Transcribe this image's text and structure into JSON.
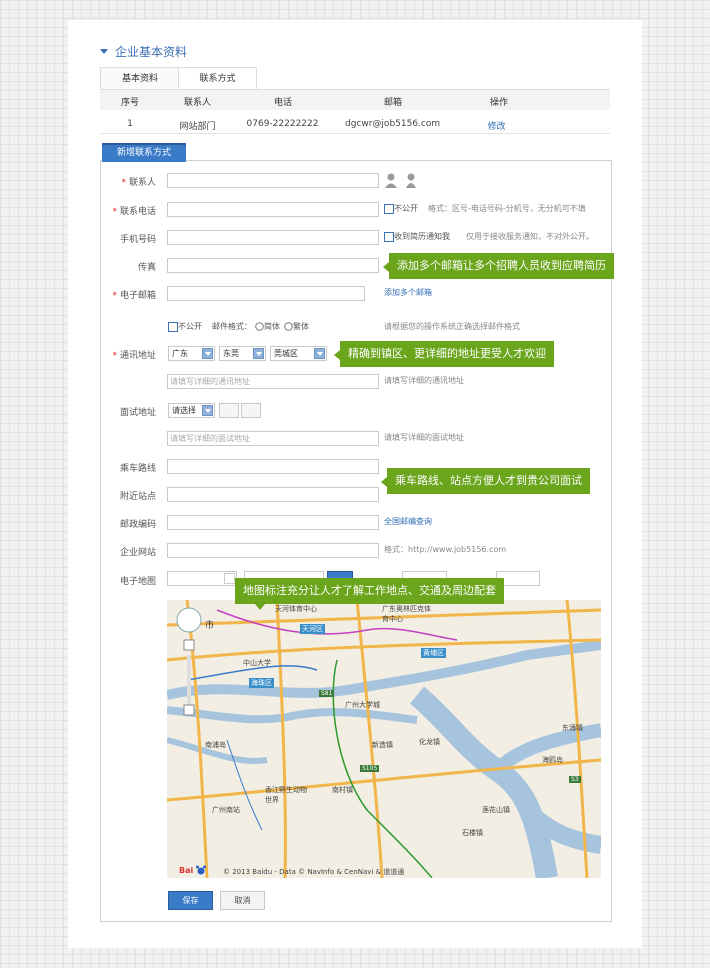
{
  "section_title": "企业基本资料",
  "tabs": [
    {
      "label": "基本资料"
    },
    {
      "label": "联系方式"
    }
  ],
  "table": {
    "headers": [
      "序号",
      "联系人",
      "电话",
      "邮箱",
      "操作"
    ],
    "rows": [
      {
        "no": "1",
        "contact": "网站部门",
        "phone": "0769-22222222",
        "email": "dgcwr@job5156.com",
        "action": "修改"
      }
    ]
  },
  "new_contact_button": "新增联系方式",
  "form": {
    "contact_label": "联系人",
    "phone_label": "联系电话",
    "phone_private": "不公开",
    "phone_hint": "格式：区号-电话号码-分机号，无分机可不填",
    "mobile_label": "手机号码",
    "mobile_notify": "收到简历通知我",
    "mobile_hint": "仅用于接收服务通知，不对外公开。",
    "fax_label": "传真",
    "email_label": "电子邮箱",
    "add_email_link": "添加多个邮箱",
    "email_private": "不公开",
    "email_format_label": "邮件格式：",
    "email_format_simplified": "简体",
    "email_format_traditional": "繁体",
    "email_format_hint": "请根据您的操作系统正确选择邮件格式",
    "address_label": "通讯地址",
    "province": "广东",
    "city": "东莞",
    "district": "莞城区",
    "address_placeholder": "请填写详细的通讯地址",
    "address_hint": "请填写详细的通讯地址",
    "interview_label": "面试地址",
    "interview_select": "请选择",
    "interview_placeholder": "请填写详细的面试地址",
    "interview_hint": "请填写详细的面试地址",
    "bus_label": "乘车路线",
    "station_label": "附近站点",
    "postcode_label": "邮政编码",
    "postcode_link": "全国邮编查询",
    "website_label": "企业网站",
    "website_hint": "格式：http://www.job5156.com",
    "map_label": "电子地图"
  },
  "callouts": {
    "email": "添加多个邮箱让多个招聘人员收到应聘简历",
    "address": "精确到镇区、更详细的地址更受人才欢迎",
    "route": "乘车路线、站点方便人才到贵公司面试",
    "map": "地图标注充分让人才了解工作地点、交通及周边配套"
  },
  "map": {
    "copyright": "© 2013 Baidu - Data © NavInfo & CenNavi & 道道通",
    "labels": [
      "天河体育中心",
      "广东奥林匹克体育中心",
      "天河区",
      "黄埔区",
      "中山大学",
      "海珠区",
      "广州大学城",
      "南浦岛",
      "新造镇",
      "化龙镇",
      "香江野生动物世界",
      "南村镇",
      "广州南站",
      "石楼镇",
      "莲花山镇",
      "东涌镇",
      "海鸥岛",
      "市"
    ],
    "roads": [
      "S81",
      "S105",
      "S3"
    ]
  },
  "save_button": "保存",
  "cancel_button": "取消",
  "colors": {
    "accent": "#3a6fb4",
    "callout": "#6aa51c",
    "required": "#d22222"
  }
}
